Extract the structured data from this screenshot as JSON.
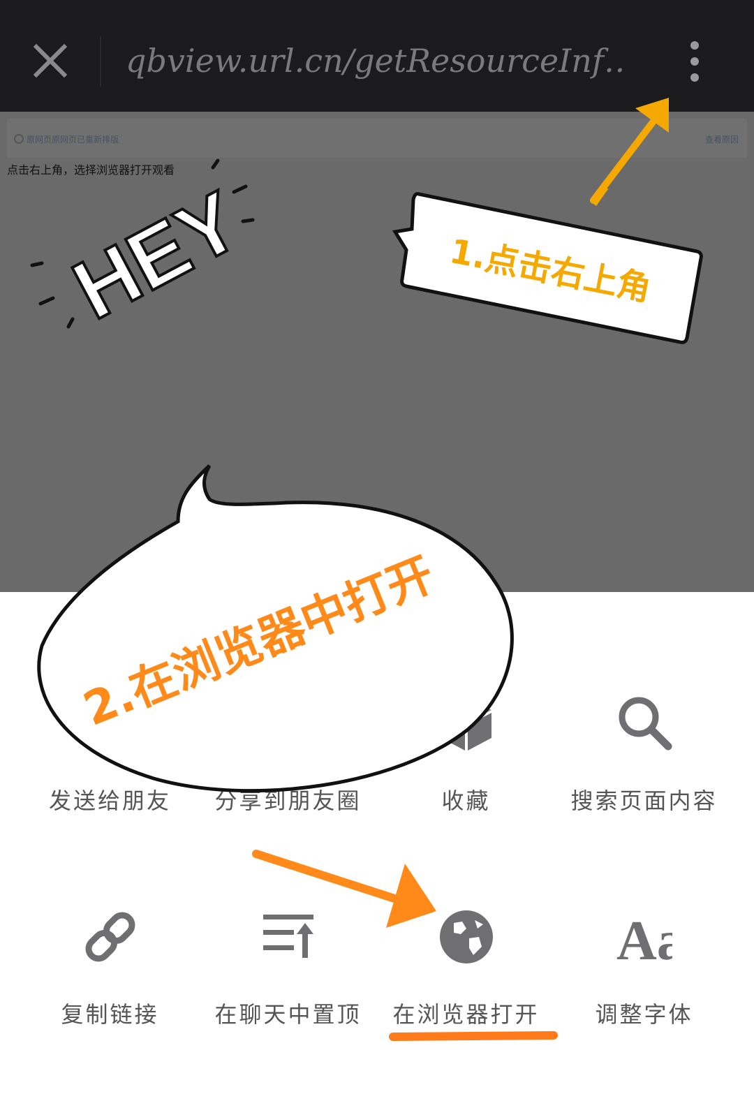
{
  "topbar": {
    "url": "qbview.url.cn/getResourceInf…",
    "close_icon": "close-icon",
    "more_icon": "more-vertical-icon"
  },
  "notice": {
    "left_text": "原网页原网页已重新排版",
    "right_text": "查看原因"
  },
  "page_text": "点击右上角，选择浏览器打开观看",
  "stickers": {
    "hey": "HEY",
    "step1": "1.点击右上角",
    "step2": "2.在浏览器中打开"
  },
  "menu": {
    "row1": [
      {
        "label": "发送给朋友",
        "icon": "send-icon"
      },
      {
        "label": "分享到朋友圈",
        "icon": "moments-icon"
      },
      {
        "label": "收藏",
        "icon": "favorite-box-icon"
      },
      {
        "label": "搜索页面内容",
        "icon": "search-icon"
      }
    ],
    "row2": [
      {
        "label": "复制链接",
        "icon": "link-icon"
      },
      {
        "label": "在聊天中置顶",
        "icon": "pin-to-top-icon"
      },
      {
        "label": "在浏览器打开",
        "icon": "globe-icon"
      },
      {
        "label": "调整字体",
        "icon": "font-size-icon"
      }
    ]
  },
  "colors": {
    "topbar": "#1b1b1d",
    "page_dim": "#6a6a6a",
    "highlight_orange": "#ff8a1a",
    "callout_yellow": "#f5a800",
    "icon_gray": "#6f6f72"
  }
}
